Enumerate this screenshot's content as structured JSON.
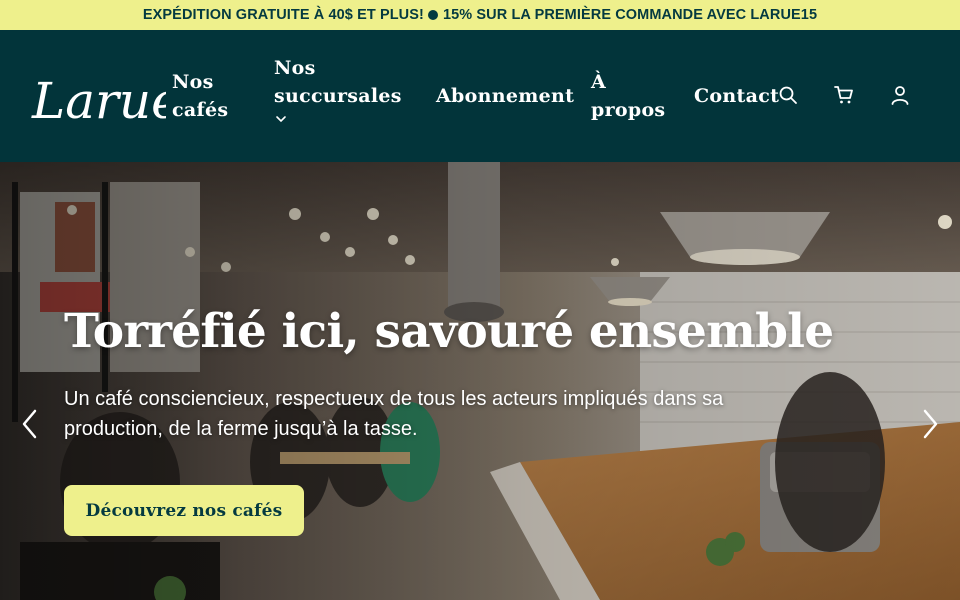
{
  "announcement": {
    "left": "EXPÉDITION GRATUITE À 40$ ET PLUS!",
    "right": "15% SUR LA PREMIÈRE COMMANDE AVEC LARUE15"
  },
  "header": {
    "logo_text": "Larue",
    "nav": [
      {
        "line1": "Nos",
        "line2": "cafés"
      },
      {
        "line1": "Nos",
        "line2": "succursales"
      },
      {
        "line1": "Abonnement"
      },
      {
        "line1": "À",
        "line2": "propos"
      },
      {
        "line1": "Contact"
      }
    ],
    "icons": [
      "search-icon",
      "cart-icon",
      "account-icon"
    ]
  },
  "hero": {
    "title": "Torréfié ici, savouré ensemble",
    "subtitle": "Un café consciencieux, respectueux de tous les acteurs impliqués dans sa production, de la ferme jusqu’à la tasse.",
    "cta": "Découvrez nos cafés"
  },
  "colors": {
    "accent": "#eef08c",
    "header_bg": "#02343a",
    "text_dark": "#043a40"
  }
}
